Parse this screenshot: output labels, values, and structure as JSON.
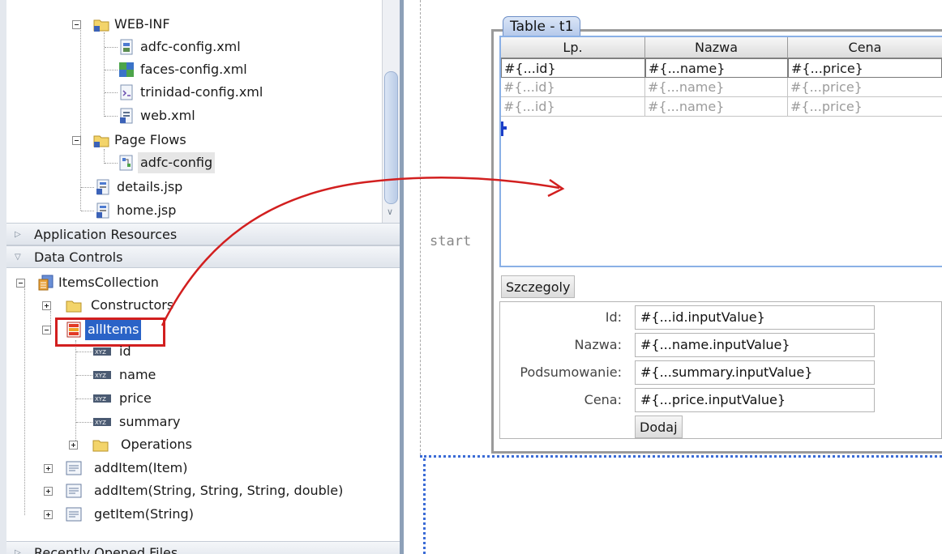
{
  "navigator": {
    "tree": [
      {
        "label": "WEB-INF",
        "icon": "folder-icon"
      },
      {
        "label": "adfc-config.xml",
        "icon": "xml-file-icon"
      },
      {
        "label": "faces-config.xml",
        "icon": "faces-config-icon"
      },
      {
        "label": "trinidad-config.xml",
        "icon": "xml-file-icon"
      },
      {
        "label": "web.xml",
        "icon": "xml-file-icon"
      },
      {
        "label": "Page Flows",
        "icon": "folder-icon"
      },
      {
        "label": "adfc-config",
        "icon": "task-flow-icon"
      },
      {
        "label": "details.jsp",
        "icon": "jsp-file-icon"
      },
      {
        "label": "home.jsp",
        "icon": "jsp-file-icon"
      }
    ],
    "sections": {
      "application_resources": "Application Resources",
      "data_controls": "Data Controls",
      "recently_opened": "Recently Opened Files"
    },
    "data_controls": [
      {
        "label": "ItemsCollection",
        "icon": "data-control-icon"
      },
      {
        "label": "Constructors",
        "icon": "folder-icon"
      },
      {
        "label": "allItems",
        "icon": "collection-icon"
      },
      {
        "label": "id",
        "icon": "attribute-icon"
      },
      {
        "label": "name",
        "icon": "attribute-icon"
      },
      {
        "label": "price",
        "icon": "attribute-icon"
      },
      {
        "label": "summary",
        "icon": "attribute-icon"
      },
      {
        "label": "Operations",
        "icon": "folder-icon"
      },
      {
        "label": "addItem(Item)",
        "icon": "method-icon"
      },
      {
        "label": "addItem(String, String, String, double)",
        "icon": "method-icon"
      },
      {
        "label": "getItem(String)",
        "icon": "method-icon"
      }
    ]
  },
  "designer": {
    "start_label": "start",
    "table_title": "Table - t1",
    "columns": [
      "Lp.",
      "Nazwa",
      "Cena"
    ],
    "rows": [
      [
        "#{...id}",
        "#{...name}",
        "#{...price}"
      ],
      [
        "#{...id}",
        "#{...name}",
        "#{...price}"
      ],
      [
        "#{...id}",
        "#{...name}",
        "#{...price}"
      ]
    ],
    "details_button": "Szczegoly",
    "form": [
      {
        "label": "Id:",
        "value": "#{...id.inputValue}"
      },
      {
        "label": "Nazwa:",
        "value": "#{...name.inputValue}"
      },
      {
        "label": "Podsumowanie:",
        "value": "#{...summary.inputValue}"
      },
      {
        "label": "Cena:",
        "value": "#{...price.inputValue}"
      }
    ],
    "add_button": "Dodaj"
  },
  "colors": {
    "highlight": "#d21f1f",
    "selection": "#2a63c7",
    "table_border": "#8ab0e6",
    "drop_outline": "#3a6bd6"
  }
}
